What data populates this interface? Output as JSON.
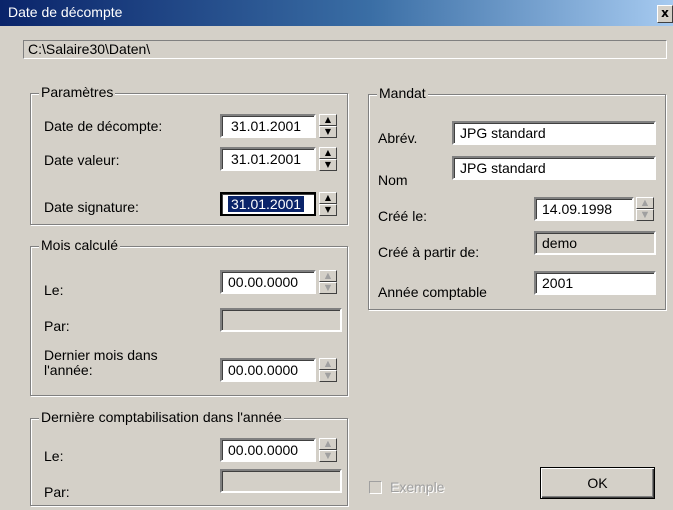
{
  "window": {
    "title": "Date de décompte",
    "close_label": "x"
  },
  "path": "C:\\Salaire30\\Daten\\",
  "parametres": {
    "legend": "Paramètres",
    "date_decompte_label": "Date de décompte:",
    "date_decompte_value": "31.01.2001",
    "date_valeur_label": "Date valeur:",
    "date_valeur_value": "31.01.2001",
    "date_signature_label": "Date signature:",
    "date_signature_value": "31.01.2001"
  },
  "mois_calcule": {
    "legend": "Mois calculé",
    "le_label": "Le:",
    "le_value": "00.00.0000",
    "par_label": "Par:",
    "par_value": "",
    "dernier_label": "Dernier mois dans l'année:",
    "dernier_value": "00.00.0000"
  },
  "derniere_compta": {
    "legend": "Dernière comptabilisation dans l'année",
    "le_label": "Le:",
    "le_value": "00.00.0000",
    "par_label": "Par:",
    "par_value": ""
  },
  "mandat": {
    "legend": "Mandat",
    "abrev_label": "Abrév.",
    "abrev_value": "JPG standard",
    "nom_label": "Nom",
    "nom_value": "JPG standard",
    "cree_le_label": "Créé le:",
    "cree_le_value": "14.09.1998",
    "cree_a_partir_label": "Créé à partir de:",
    "cree_a_partir_value": "demo",
    "annee_label": "Année comptable",
    "annee_value": "2001"
  },
  "exemple": {
    "label": "Exemple",
    "checked": false,
    "enabled": false
  },
  "ok_label": "OK",
  "colors": {
    "title_bar": "#0a246a",
    "window_bg": "#d4d0c8",
    "selection": "#0a246a"
  },
  "icons": [
    "close-icon",
    "spin-up-icon",
    "spin-down-icon"
  ]
}
